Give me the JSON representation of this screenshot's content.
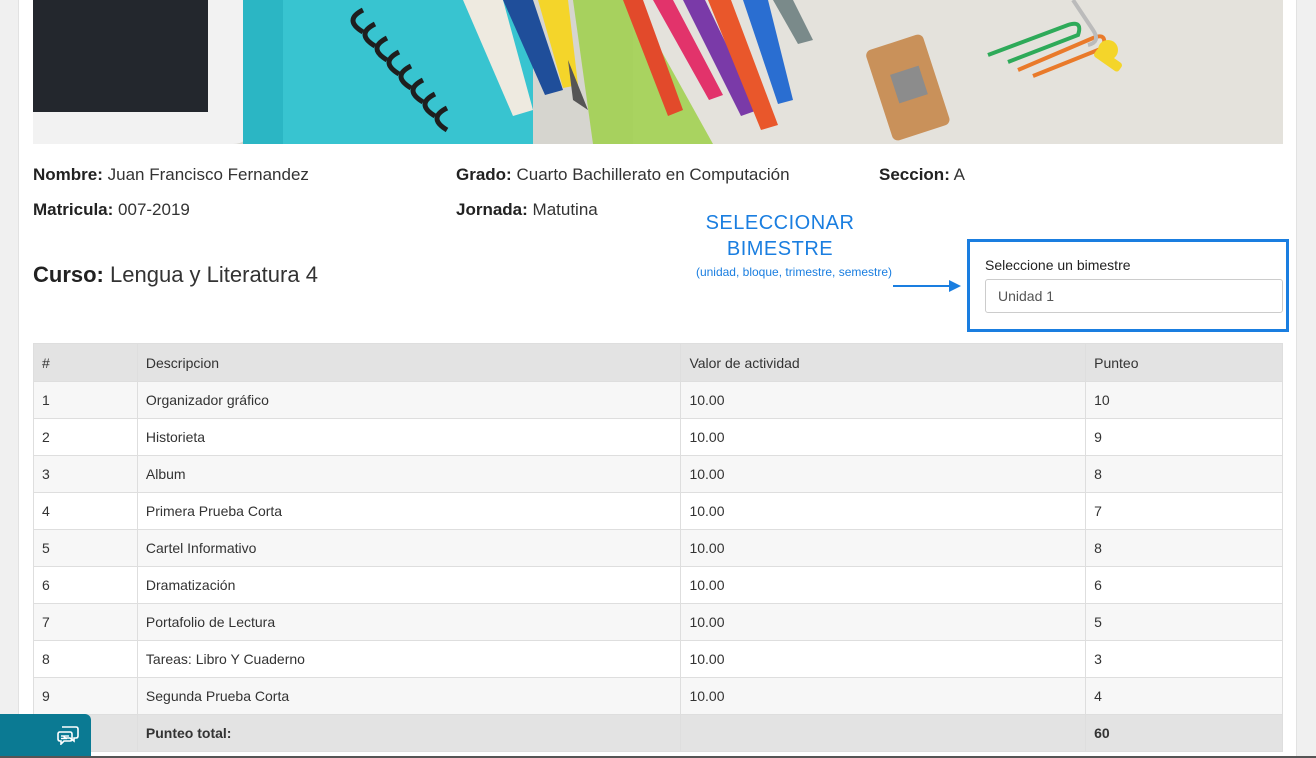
{
  "student": {
    "nombre_label": "Nombre:",
    "nombre": "Juan Francisco Fernandez",
    "grado_label": "Grado:",
    "grado": "Cuarto Bachillerato en Computación",
    "seccion_label": "Seccion:",
    "seccion": "A",
    "matricula_label": "Matricula:",
    "matricula": "007-2019",
    "jornada_label": "Jornada:",
    "jornada": "Matutina"
  },
  "course": {
    "label": "Curso:",
    "name": "Lengua y Literatura 4"
  },
  "annotation": {
    "title_line1": "SELECCIONAR",
    "title_line2": "BIMESTRE",
    "subtitle": "(unidad, bloque, trimestre, semestre)"
  },
  "selector": {
    "label": "Seleccione un bimestre",
    "value": "Unidad 1"
  },
  "table": {
    "headers": [
      "#",
      "Descripcion",
      "Valor de actividad",
      "Punteo"
    ],
    "rows": [
      [
        "1",
        "Organizador gráfico",
        "10.00",
        "10"
      ],
      [
        "2",
        "Historieta",
        "10.00",
        "9"
      ],
      [
        "3",
        "Album",
        "10.00",
        "8"
      ],
      [
        "4",
        "Primera Prueba Corta",
        "10.00",
        "7"
      ],
      [
        "5",
        "Cartel Informativo",
        "10.00",
        "8"
      ],
      [
        "6",
        "Dramatización",
        "10.00",
        "6"
      ],
      [
        "7",
        "Portafolio de Lectura",
        "10.00",
        "5"
      ],
      [
        "8",
        "Tareas: Libro Y Cuaderno",
        "10.00",
        "3"
      ],
      [
        "9",
        "Segunda Prueba Corta",
        "10.00",
        "4"
      ]
    ],
    "total_label": "Punteo total:",
    "total_value": "60"
  },
  "icons": {
    "chat": "chat-bubbles-icon"
  },
  "colors": {
    "accent": "#1a7ee0",
    "chat_button": "#0b7a93"
  }
}
